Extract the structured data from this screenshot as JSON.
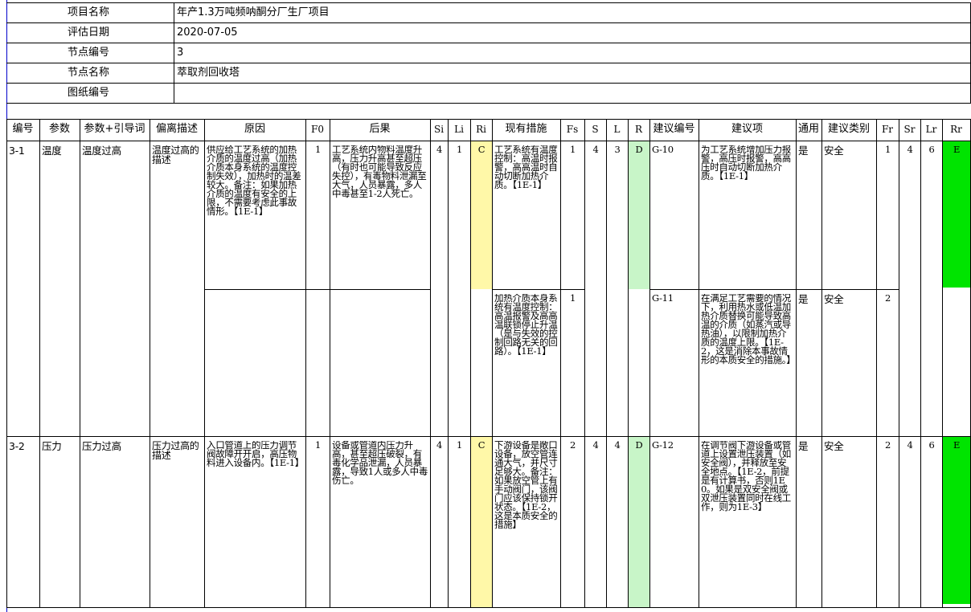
{
  "info": {
    "project_label": "项目名称",
    "project_value": "年产1.3万吨频呐酮分厂生厂项目",
    "date_label": "评估日期",
    "date_value": "2020-07-05",
    "node_no_label": "节点编号",
    "node_no_value": "3",
    "node_name_label": "节点名称",
    "node_name_value": "萃取剂回收塔",
    "drawing_label": "图纸编号",
    "drawing_value": ""
  },
  "headers": [
    "编号",
    "参数",
    "参数+引导词",
    "偏离描述",
    "原因",
    "F0",
    "后果",
    "Si",
    "Li",
    "Ri",
    "现有措施",
    "Fs",
    "S",
    "L",
    "R",
    "建议编号",
    "建议项",
    "通用",
    "建议类别",
    "Fr",
    "Sr",
    "Lr",
    "Rr"
  ],
  "colors": {
    "ri_fill": "#fff8a8",
    "r_fill": "#c8f5c8",
    "rr_fill": "#00e400",
    "line": "#000000",
    "left_accent": "#0000cc"
  },
  "rows": [
    {
      "id": "3-1",
      "param": "温度",
      "guide": "温度过高",
      "deviation": "温度过高的描述",
      "causes": [
        {
          "text": "供应给工艺系统的加热介质的温度过高（加热介质本身系统的温度控制失效），加热时的温差较大。备注：如果加热介质的温度有安全的上限，不需要考虑此事故情形。【1E-1】",
          "f0": "1"
        },
        {
          "text": "",
          "f0": ""
        }
      ],
      "consequence": "工艺系统内物料温度升高，压力升高甚至超压（有时也可能导致反应失控），有毒物料泄漏至大气，人员暴露，多人中毒甚至1-2人死亡。",
      "si": "4",
      "li": "1",
      "ri": "C",
      "measures": [
        {
          "text": "工艺系统有温度控制：高温时报警，高高温时自动切断加热介质。【1E-1】",
          "fs": "1"
        },
        {
          "text": "加热介质本身系统有温度控制：高温报警及高高温联锁停止升温（是与失效的控制回路无关的回路）。【1E-1】",
          "fs": "1"
        }
      ],
      "s": "4",
      "l": "3",
      "r": "D",
      "recommendations": [
        {
          "no": "G-10",
          "text": "为工艺系统增加压力报警，高压时报警，高高压时自动切断加热介质。【1E-1】",
          "general": "是",
          "category": "安全",
          "fr": "1"
        },
        {
          "no": "G-11",
          "text": "在满足工艺需要的情况下，利用热水或低温加热介质替换可能导致高温的介质（如蒸汽或导热油），以限制加热介质的温度上限。【1E-2，这是消除本事故情形的本质安全的措施。】",
          "general": "是",
          "category": "安全",
          "fr": "2"
        }
      ],
      "sr": "4",
      "lr": "6",
      "rr": "E"
    },
    {
      "id": "3-2",
      "param": "压力",
      "guide": "压力过高",
      "deviation": "压力过高的描述",
      "causes": [
        {
          "text": "入口管道上的压力调节阀故障开开启，高压物料进入设备内。【1E-1】",
          "f0": "1"
        }
      ],
      "consequence": "设备或管道内压力升高，甚至超压破裂，有毒化学品泄漏，人员暴露，导致1人或多人中毒伤亡。",
      "si": "4",
      "li": "1",
      "ri": "C",
      "measures": [
        {
          "text": "下游设备是敞口设备，放空管连通大气，并尺寸足够大。备注：如果放空管上有手动阀门，该阀门应该保持锁开状态。【1E-2，这是本质安全的措施】",
          "fs": "2"
        }
      ],
      "s": "4",
      "l": "4",
      "r": "D",
      "recommendations": [
        {
          "no": "G-12",
          "text": "在调节阀下游设备或管道上设置泄压装置（如安全阀），并释放至安全地点。【1E-2，前提是有计算书，否则1E0。如果是双安全阀或双泄压装置同时在线工作，则为1E-3】",
          "general": "是",
          "category": "安全",
          "fr": "2"
        }
      ],
      "sr": "4",
      "lr": "6",
      "rr": "E"
    }
  ]
}
